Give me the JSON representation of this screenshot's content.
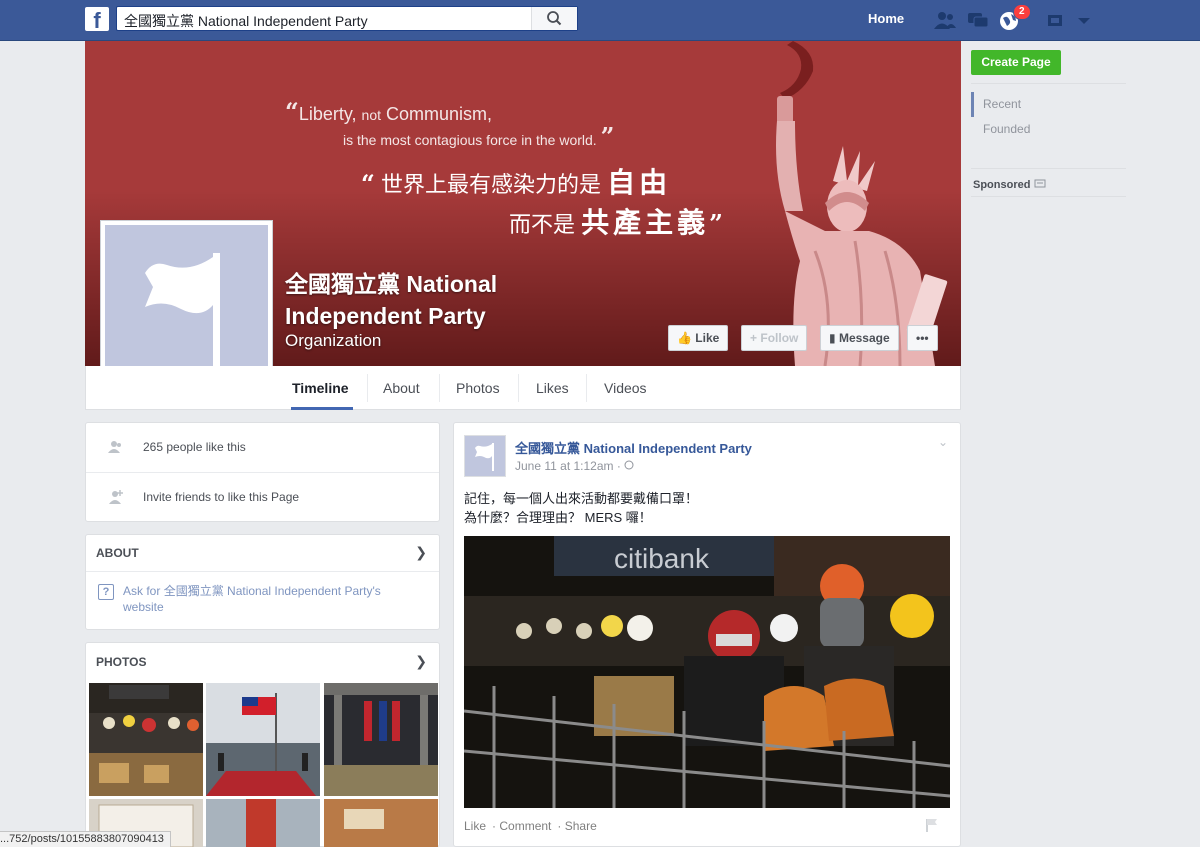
{
  "topbar": {
    "logo": "f",
    "search_value": "全國獨立黨 National Independent Party",
    "home_label": "Home",
    "notification_count": "2",
    "icons": [
      "friends-icon",
      "messages-icon",
      "notifications-globe-icon",
      "privacy-shortcuts-icon",
      "account-dropdown-icon"
    ]
  },
  "cover": {
    "quote_en_line1_a": "Liberty,",
    "quote_en_line1_b": "not",
    "quote_en_line1_c": "Communism,",
    "quote_en_line2": "is the most contagious force in the world.",
    "quote_zh_line1_a": "世界上最有感染力的是",
    "quote_zh_line1_b": "自由",
    "quote_zh_line2_a": "而不是",
    "quote_zh_line2_b": "共產主義",
    "open_quote": "“",
    "close_quote": "”",
    "page_name": "全國獨立黨 National Independent Party",
    "page_category": "Organization",
    "buttons": {
      "like": "Like",
      "follow": "Follow",
      "message": "Message",
      "more": "•••"
    },
    "colors": {
      "background": "#a63a3a"
    }
  },
  "tabs": [
    "Timeline",
    "About",
    "Photos",
    "Likes",
    "Videos"
  ],
  "right_rail": {
    "create_page": "Create Page",
    "nav": [
      "Recent",
      "Founded"
    ],
    "sponsored": "Sponsored"
  },
  "left": {
    "likes_text": "265 people like this",
    "invite_text": "Invite friends to like this Page",
    "about_header": "ABOUT",
    "about_link_prefix": "Ask for ",
    "about_link_name": "全國獨立黨 National Independent Party",
    "about_link_suffix": "'s website",
    "photos_header": "PHOTOS",
    "help_glyph": "?"
  },
  "post": {
    "author": "全國獨立黨 National Independent Party",
    "time": "June 11 at 1:12am",
    "text_line1": "記住，每一個人出來活動都要戴備口罩！",
    "text_line2": "為什麼？合理理由？ MERS 囉！",
    "photo_sign": "citibank",
    "actions": [
      "Like",
      "Comment",
      "Share"
    ]
  },
  "statusbar": "...752/posts/10155883807090413"
}
